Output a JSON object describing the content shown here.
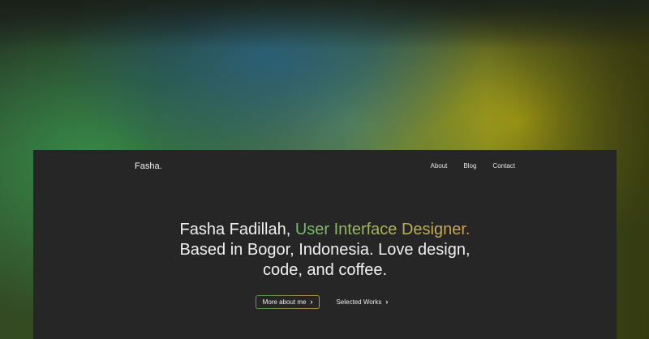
{
  "header": {
    "logo": "Fasha.",
    "nav": [
      {
        "label": "About"
      },
      {
        "label": "Blog"
      },
      {
        "label": "Contact"
      }
    ]
  },
  "hero": {
    "name_prefix": "Fasha Fadillah, ",
    "role": "User Interface Designer.",
    "line2": "Based in Bogor, Indonesia. Love design,",
    "line3": "code, and coffee."
  },
  "actions": {
    "primary_label": "More about me",
    "secondary_label": "Selected Works",
    "chevron_glyph": "›"
  },
  "colors": {
    "panel_bg": "#262626",
    "role_gradient_start": "#6fbf6a",
    "role_gradient_end": "#d1a15a"
  }
}
